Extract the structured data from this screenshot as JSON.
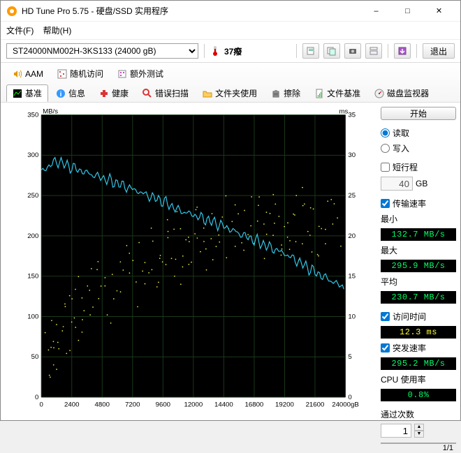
{
  "window": {
    "title": "HD Tune Pro 5.75 - 硬盘/SSD 实用程序"
  },
  "menu": {
    "file": "文件(F)",
    "help": "帮助(H)"
  },
  "toolbar": {
    "drive": "ST24000NM002H-3KS133 (24000 gB)",
    "temp": "37癈",
    "exit": "退出"
  },
  "tabs_row1": {
    "aam": "AAM",
    "random": "随机访问",
    "extra": "额外测试"
  },
  "tabs_row2": {
    "base": "基准",
    "info": "信息",
    "health": "健康",
    "error": "错误扫描",
    "folder": "文件夹使用",
    "erase": "擦除",
    "filebase": "文件基准",
    "monitor": "磁盘监视器"
  },
  "side": {
    "start": "开始",
    "read": "读取",
    "write": "写入",
    "short_trip": "短行程",
    "short_val": "40",
    "gb": "GB",
    "transfer_rate": "传输速率",
    "min_lbl": "最小",
    "min_val": "132.7 MB/s",
    "max_lbl": "最大",
    "max_val": "295.9 MB/s",
    "avg_lbl": "平均",
    "avg_val": "230.7 MB/s",
    "access_lbl": "访问时间",
    "access_val": "12.3 ms",
    "burst_lbl": "突发速率",
    "burst_val": "295.2 MB/s",
    "cpu_lbl": "CPU 使用率",
    "cpu_val": "0.8%",
    "pass_lbl": "通过次数",
    "pass_val": "1",
    "progress": "1/1"
  },
  "chart_data": {
    "type": "line+scatter",
    "title": "",
    "xlabel": "gB",
    "ylabel_left": "MB/s",
    "ylabel_right": "ms",
    "xlim": [
      0,
      24000
    ],
    "ylim_left": [
      0,
      350
    ],
    "ylim_right": [
      0,
      35
    ],
    "x_ticks": [
      0,
      2400,
      4800,
      7200,
      9600,
      12000,
      14400,
      16800,
      19200,
      21600,
      24000
    ],
    "y_ticks_left": [
      0,
      50,
      100,
      150,
      200,
      250,
      300,
      350
    ],
    "y_ticks_right": [
      0,
      5,
      10,
      15,
      20,
      25,
      30,
      35
    ],
    "transfer_line_mb_s": {
      "x": [
        0,
        1200,
        2400,
        3600,
        4800,
        6000,
        7200,
        8400,
        9600,
        10800,
        12000,
        13200,
        14400,
        15600,
        16800,
        18000,
        19200,
        20400,
        21600,
        22800,
        24000
      ],
      "y": [
        280,
        293,
        285,
        278,
        272,
        265,
        258,
        250,
        243,
        232,
        226,
        219,
        212,
        203,
        195,
        186,
        178,
        167,
        155,
        145,
        135
      ]
    },
    "access_scatter_ms": {
      "x": [
        300,
        600,
        900,
        1500,
        2000,
        2600,
        3000,
        3600,
        4200,
        4800,
        5400,
        6000,
        6600,
        7200,
        7800,
        8400,
        9000,
        9600,
        10200,
        10800,
        11400,
        12000,
        12600,
        13200,
        13800,
        14400,
        15000,
        15600,
        16200,
        16800,
        17400,
        18000,
        18600,
        19200,
        19800,
        20400,
        21000,
        21600,
        22200,
        22800,
        23400
      ],
      "y": [
        5,
        7,
        6,
        9,
        8,
        10,
        12,
        11,
        13,
        14,
        12,
        15,
        16,
        14,
        17,
        18,
        15,
        19,
        18,
        20,
        17,
        19,
        21,
        18,
        20,
        22,
        19,
        21,
        23,
        22,
        20,
        23,
        21,
        19,
        22,
        20,
        23,
        21,
        20,
        22,
        21
      ]
    }
  }
}
